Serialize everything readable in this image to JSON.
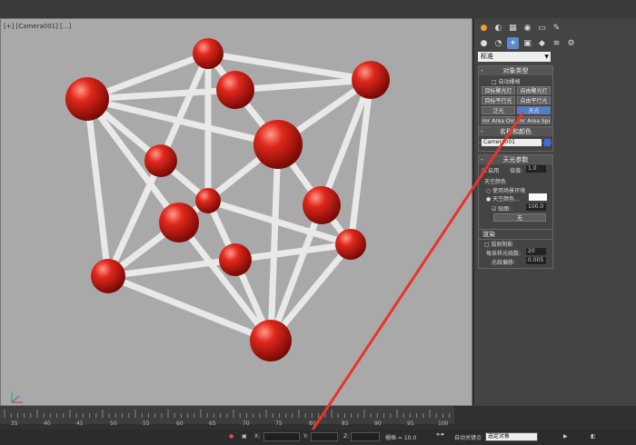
{
  "viewport": {
    "label": "[+] [Camera001] [...]"
  },
  "panel": {
    "preset": "标准",
    "object_type": {
      "title": "对象类型",
      "auto_grid": "自动栅格",
      "buttons": [
        "目标聚光灯",
        "自由聚光灯",
        "目标平行光",
        "自由平行光",
        "泛光",
        "天光",
        "mr Area Omni",
        "mr Area Spot"
      ]
    },
    "name_color": {
      "title": "名称和颜色",
      "name": "Camera001"
    },
    "skylight": {
      "title": "天光参数",
      "enable": "启用",
      "multiplier_label": "倍增:",
      "multiplier": "1.0",
      "sky_color": "天空颜色",
      "use_env": "使用场景环境",
      "sky_color_opt": "天空颜色...",
      "map_label": "贴图:",
      "map_value": "100.0",
      "none": "无"
    },
    "render": {
      "title": "渲染",
      "cast_shadows": "投射阴影",
      "rays_label": "每采样光线数:",
      "rays": "20",
      "bias_label": "光线偏移:",
      "bias": "0.005"
    }
  },
  "timeline": {
    "ticks": [
      "35",
      "40",
      "45",
      "50",
      "55",
      "60",
      "65",
      "70",
      "75",
      "80",
      "85",
      "90",
      "95",
      "100"
    ]
  },
  "status": {
    "x_label": "X:",
    "y_label": "Y:",
    "z_label": "Z:",
    "grid": "栅格 = 10.0",
    "auto_key": "自动关键点",
    "selected": "选定对象"
  }
}
